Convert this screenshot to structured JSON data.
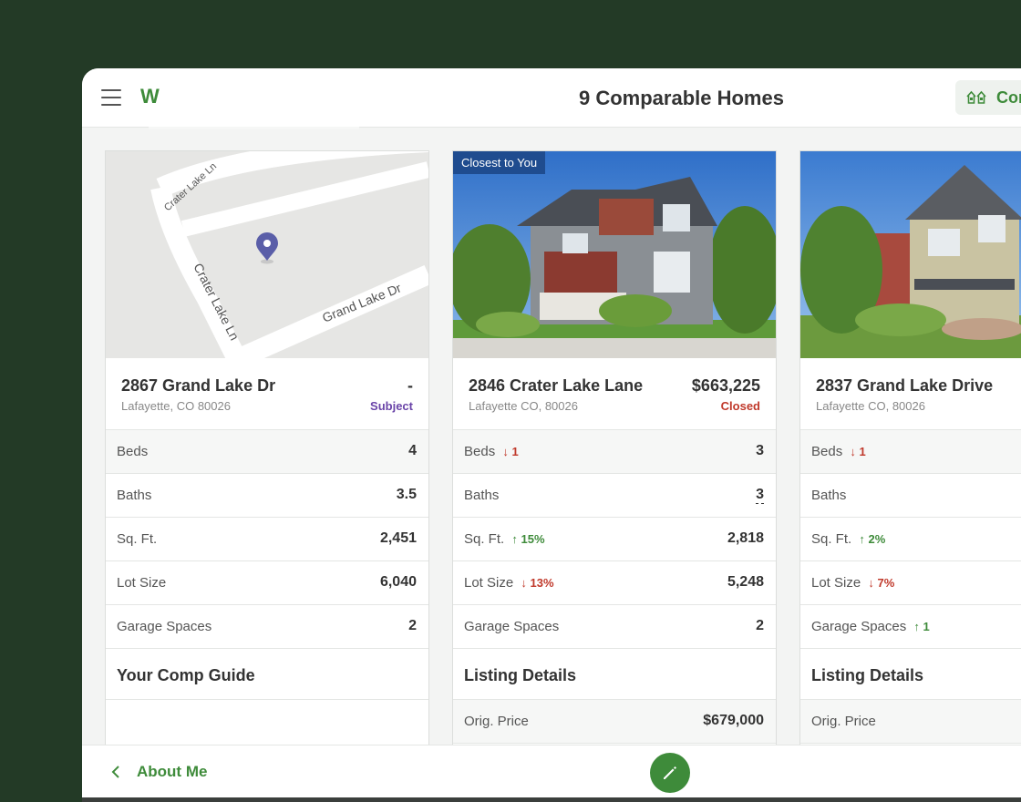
{
  "header": {
    "logo_text": "W",
    "title": "9 Comparable Homes",
    "compare_label": "Compare"
  },
  "cards": [
    {
      "map": {
        "street_1": "Crater Lake Ln",
        "street_2": "Crater Lake Ln",
        "street_3": "Grand Lake Dr"
      },
      "address": "2867 Grand Lake Dr",
      "city": "Lafayette, CO 80026",
      "price": "-",
      "status": "Subject",
      "rows": [
        {
          "label": "Beds",
          "diff": "",
          "value": "4"
        },
        {
          "label": "Baths",
          "diff": "",
          "value": "3.5"
        },
        {
          "label": "Sq. Ft.",
          "diff": "",
          "value": "2,451"
        },
        {
          "label": "Lot Size",
          "diff": "",
          "value": "6,040"
        },
        {
          "label": "Garage Spaces",
          "diff": "",
          "value": "2"
        }
      ],
      "section_title": "Your Comp Guide"
    },
    {
      "badge": "Closest to You",
      "address": "2846 Crater Lake Lane",
      "city": "Lafayette CO, 80026",
      "price": "$663,225",
      "status": "Closed",
      "rows": [
        {
          "label": "Beds",
          "diff": "1",
          "value": "3"
        },
        {
          "label": "Baths",
          "diff": "",
          "value": "3"
        },
        {
          "label": "Sq. Ft.",
          "diff": "15%",
          "value": "2,818"
        },
        {
          "label": "Lot Size",
          "diff": "13%",
          "value": "5,248"
        },
        {
          "label": "Garage Spaces",
          "diff": "",
          "value": "2"
        }
      ],
      "section_title": "Listing Details",
      "extra_row": {
        "label": "Orig. Price",
        "value": "$679,000"
      }
    },
    {
      "address": "2837 Grand Lake Drive",
      "city": "Lafayette CO, 80026",
      "rows": [
        {
          "label": "Beds",
          "diff": "1"
        },
        {
          "label": "Baths",
          "diff": ""
        },
        {
          "label": "Sq. Ft.",
          "diff": "2%"
        },
        {
          "label": "Lot Size",
          "diff": "7%"
        },
        {
          "label": "Garage Spaces",
          "diff": "1"
        }
      ],
      "section_title": "Listing Details",
      "extra_row": {
        "label": "Orig. Price"
      }
    }
  ],
  "footer": {
    "back_label": "About Me"
  },
  "colors": {
    "brand_green": "#3e8b3a",
    "down_red": "#c0392b",
    "subject_purple": "#6a44a8",
    "closed_red": "#c0392b",
    "badge_blue": "#1f4c8f"
  },
  "icons": {
    "menu": "hamburger-icon",
    "compare": "houses-icon",
    "map_pin": "map-pin-icon",
    "back": "chevron-left-icon",
    "edit": "pencil-icon",
    "arrow_up": "arrow-up-icon",
    "arrow_down": "arrow-down-icon"
  }
}
